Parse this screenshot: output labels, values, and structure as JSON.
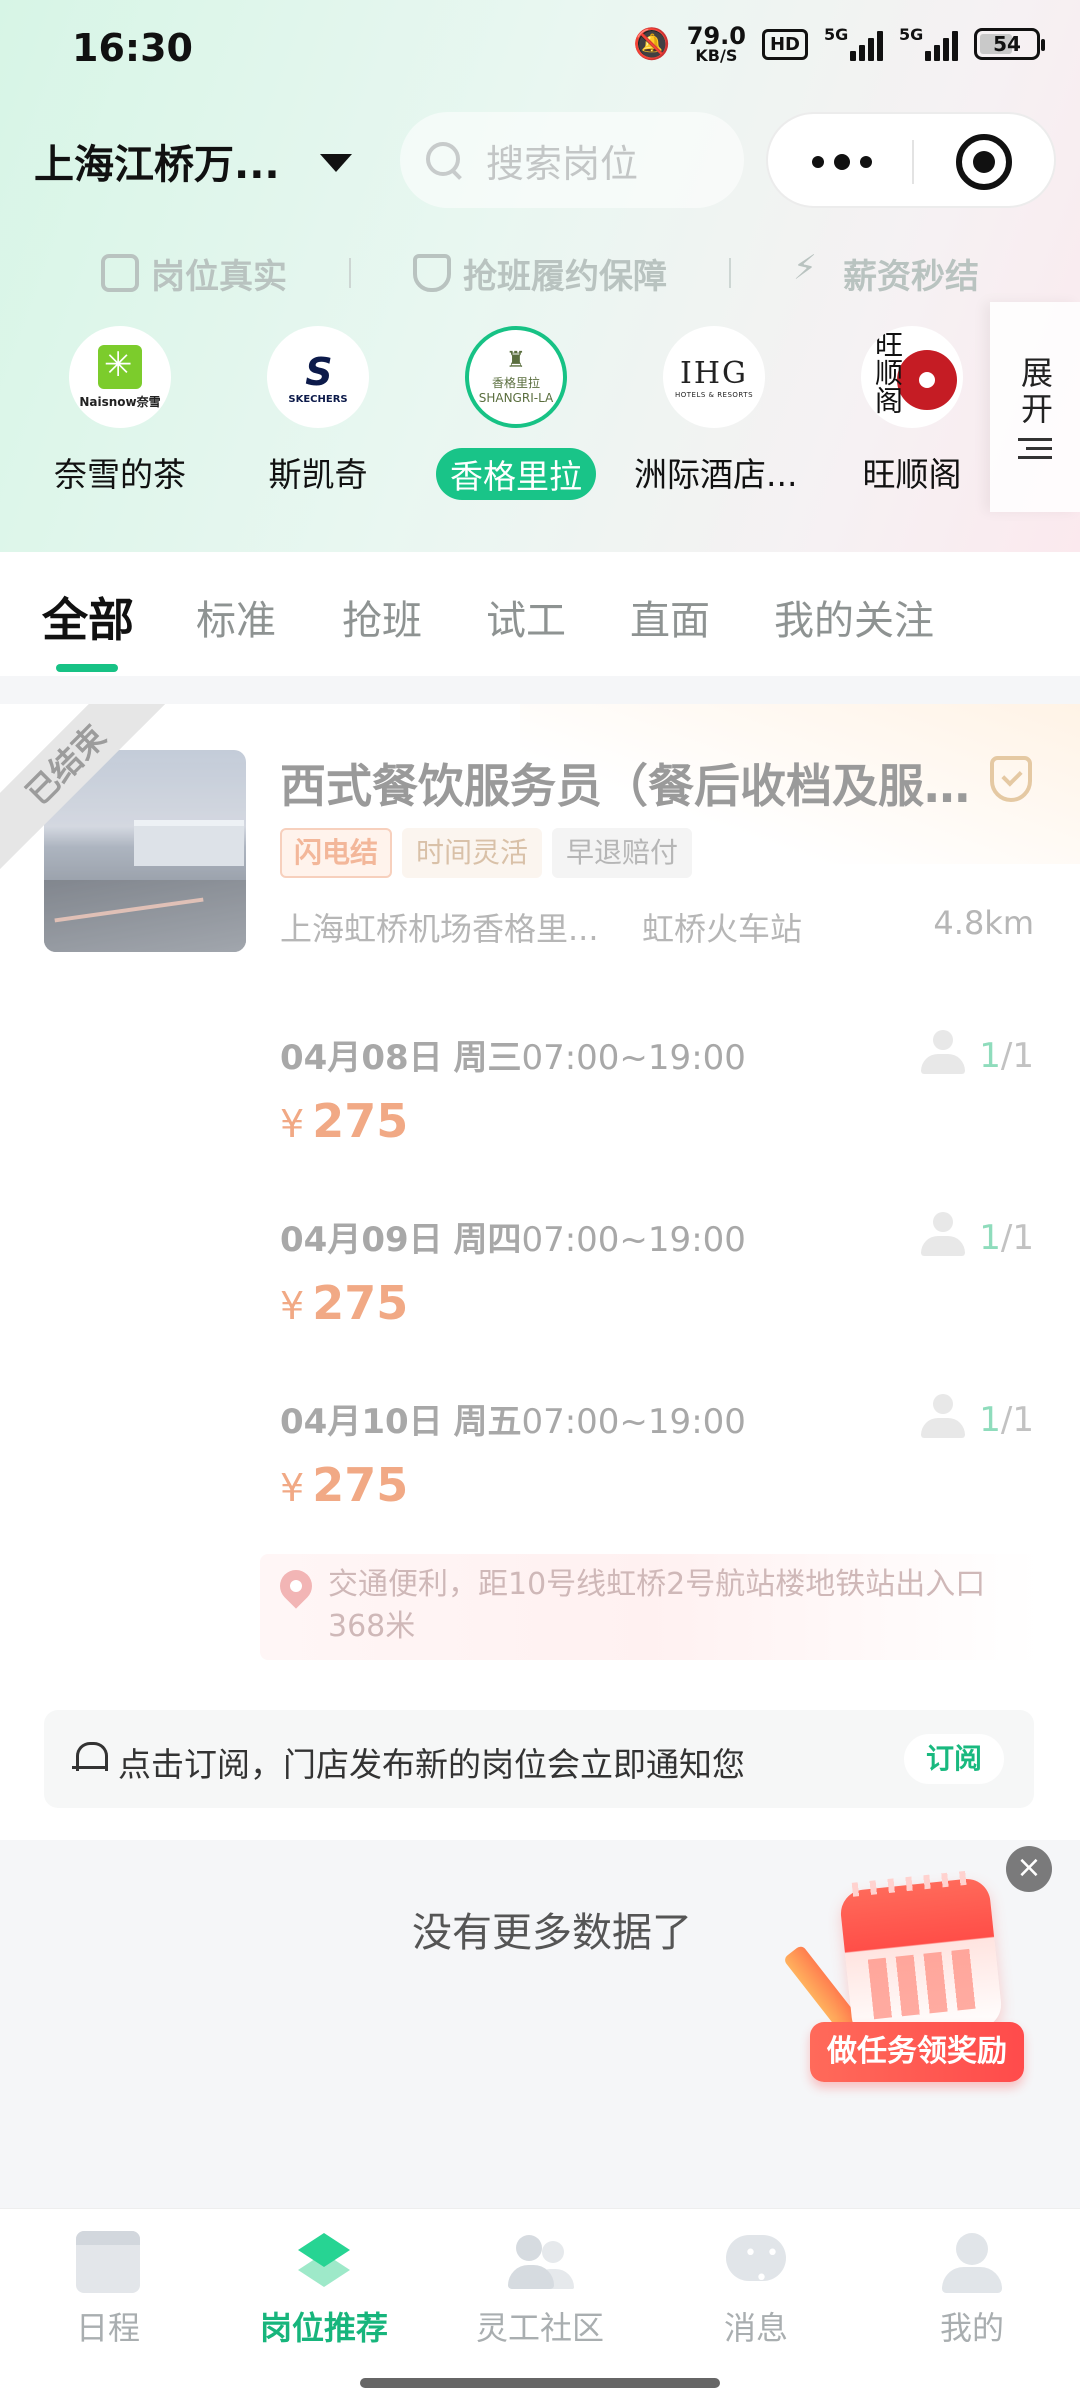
{
  "status_bar": {
    "time": "16:30",
    "net_speed_value": "79.0",
    "net_speed_unit": "KB/S",
    "hd_badge": "HD",
    "signal1_label": "5G",
    "signal2_label": "5G",
    "battery": "54"
  },
  "topbar": {
    "city": "上海江桥万...",
    "search_placeholder": "搜索岗位"
  },
  "guarantees": [
    {
      "label": "岗位真实",
      "icon": "briefcase-icon"
    },
    {
      "label": "抢班履约保障",
      "icon": "shield-check-icon"
    },
    {
      "label": "薪资秒结",
      "icon": "lightning-icon"
    }
  ],
  "brands": [
    {
      "name": "奈雪的茶",
      "logo_text": "Naisnow奈雪",
      "active": false
    },
    {
      "name": "斯凯奇",
      "logo_text": "SKECHERS",
      "active": false
    },
    {
      "name": "香格里拉",
      "logo_text": "SHANGRI-LA",
      "logo_sub": "香格里拉",
      "active": true
    },
    {
      "name": "洲际酒店...",
      "logo_text": "IHG",
      "logo_sub": "HOTELS & RESORTS",
      "active": false
    },
    {
      "name": "旺顺阁",
      "logo_text": "旺顺阁",
      "active": false
    }
  ],
  "expand_label": "展开",
  "tabs": [
    "全部",
    "标准",
    "抢班",
    "试工",
    "直面",
    "我的关注"
  ],
  "active_tab": "全部",
  "job": {
    "ribbon": "已结束",
    "title": "西式餐饮服务员（餐后收档及服务...",
    "tags": [
      "闪电结",
      "时间灵活",
      "早退赔付"
    ],
    "location": "上海虹桥机场香格里...",
    "station": "虹桥火车站",
    "distance": "4.8km",
    "shifts": [
      {
        "date": "04月08日",
        "weekday": "周三",
        "time": "07:00~19:00",
        "currency": "¥",
        "price": "275",
        "filled": "1",
        "total": "/1"
      },
      {
        "date": "04月09日",
        "weekday": "周四",
        "time": "07:00~19:00",
        "currency": "¥",
        "price": "275",
        "filled": "1",
        "total": "/1"
      },
      {
        "date": "04月10日",
        "weekday": "周五",
        "time": "07:00~19:00",
        "currency": "¥",
        "price": "275",
        "filled": "1",
        "total": "/1"
      }
    ],
    "transit": "交通便利，距10号线虹桥2号航站楼地铁站出入口368米"
  },
  "subscribe": {
    "text": "点击订阅，门店发布新的岗位会立即通知您",
    "button": "订阅"
  },
  "no_more": "没有更多数据了",
  "promo": {
    "label": "做任务领奖励",
    "close": "×"
  },
  "bottom_nav": [
    {
      "label": "日程",
      "icon": "calendar-icon",
      "active": false
    },
    {
      "label": "岗位推荐",
      "icon": "layers-icon",
      "active": true
    },
    {
      "label": "灵工社区",
      "icon": "community-icon",
      "active": false
    },
    {
      "label": "消息",
      "icon": "chat-icon",
      "active": false
    },
    {
      "label": "我的",
      "icon": "profile-icon",
      "active": false
    }
  ],
  "colors": {
    "accent": "#17c285",
    "price": "#f1a985",
    "promo": "#ff4b4b"
  }
}
